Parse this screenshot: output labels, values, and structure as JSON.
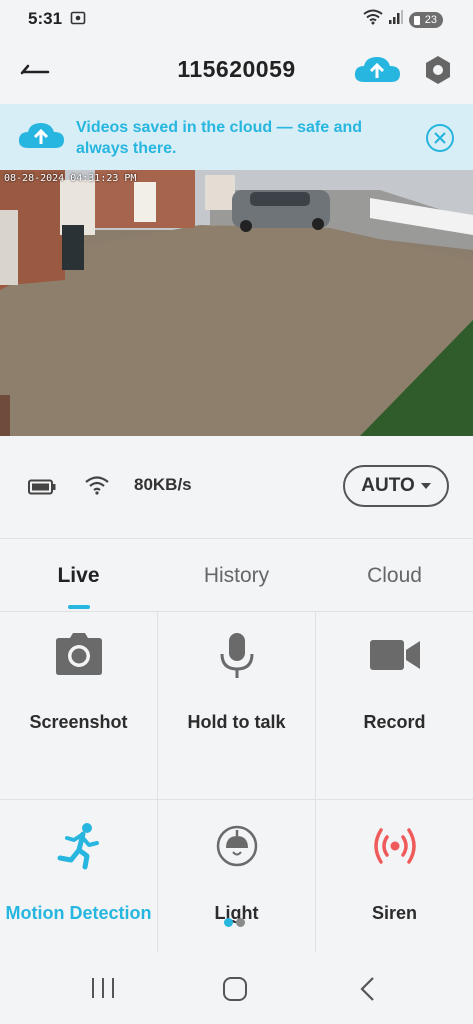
{
  "status_bar": {
    "time": "5:31",
    "battery": "23"
  },
  "header": {
    "title": "115620059"
  },
  "banner": {
    "text": "Videos saved in the cloud — safe and always there."
  },
  "video": {
    "timestamp": "08-28-2024 04:31:23 PM"
  },
  "info_bar": {
    "speed": "80KB/s",
    "quality": "AUTO"
  },
  "tabs": [
    {
      "label": "Live",
      "active": true
    },
    {
      "label": "History",
      "active": false
    },
    {
      "label": "Cloud",
      "active": false
    }
  ],
  "actions": [
    {
      "label": "Screenshot",
      "icon": "camera-icon"
    },
    {
      "label": "Hold to talk",
      "icon": "microphone-icon"
    },
    {
      "label": "Record",
      "icon": "video-camera-icon"
    },
    {
      "label": "Motion Detection",
      "icon": "running-person-icon",
      "active": true
    },
    {
      "label": "Light",
      "icon": "lamp-icon"
    },
    {
      "label": "Siren",
      "icon": "siren-icon"
    }
  ],
  "page_indicator": {
    "pages": 2,
    "current": 1
  },
  "colors": {
    "accent": "#27b6df",
    "siren": "#ef5a5a",
    "banner_bg": "#d8eef6"
  }
}
